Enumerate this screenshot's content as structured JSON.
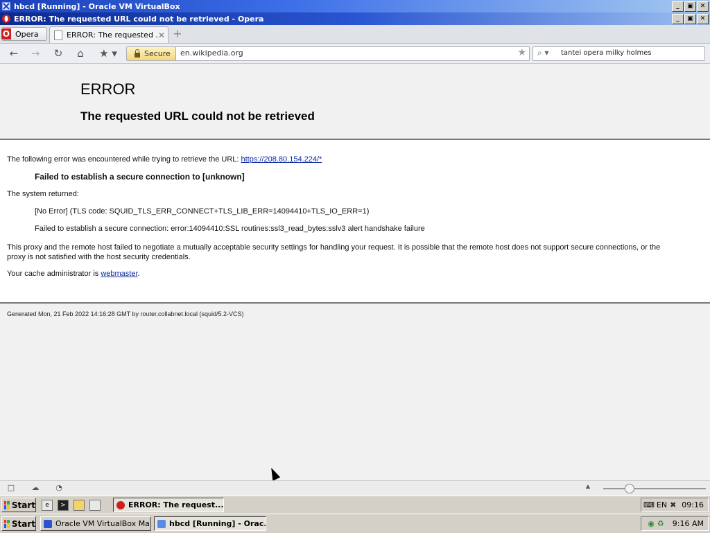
{
  "vm_window": {
    "title": "hbcd [Running] - Oracle VM VirtualBox",
    "min": "_",
    "max": "▣",
    "close": "✕"
  },
  "browser_window": {
    "title": "ERROR: The requested URL could not be retrieved - Opera",
    "min": "_",
    "max": "▣",
    "close": "✕"
  },
  "opera_menu": {
    "label": "Opera"
  },
  "tabs": [
    {
      "label": "ERROR: The requested ...",
      "close": "✕"
    }
  ],
  "new_tab": "+",
  "nav": {
    "back": "←",
    "forward": "→",
    "reload": "↻",
    "home": "⌂",
    "bookmark": "★ ▾"
  },
  "address": {
    "badge": "Secure",
    "url": "en.wikipedia.org",
    "star": "★"
  },
  "search": {
    "icon": "⌕ ▾",
    "value": "tantei opera milky holmes"
  },
  "page": {
    "title": "ERROR",
    "subtitle": "The requested URL could not be retrieved",
    "intro": "The following error was encountered while trying to retrieve the URL: ",
    "intro_link": "https://208.80.154.224/*",
    "error_heading": "Failed to establish a secure connection to [unknown]",
    "system_returned": "The system returned:",
    "tls_error": "[No Error] (TLS code: SQUID_TLS_ERR_CONNECT+TLS_LIB_ERR=14094410+TLS_IO_ERR=1)",
    "ssl_error": "Failed to establish a secure connection: error:14094410:SSL routines:ssl3_read_bytes:sslv3 alert handshake failure",
    "explanation": "This proxy and the remote host failed to negotiate a mutually acceptable security settings for handling your request. It is possible that the remote host does not support secure connections, or the proxy is not satisfied with the host security credentials.",
    "admin_prefix": "Your cache administrator is ",
    "admin_link": "webmaster",
    "admin_suffix": ".",
    "footer": "Generated Mon, 21 Feb 2022 14:16:28 GMT by router.collabnet.local (squid/5.2-VCS)"
  },
  "statusbar": {
    "panel_icon": "□",
    "cloud_icon": "☁",
    "speed_icon": "◔",
    "zoom_up": "▲",
    "zoom_level": 0.25
  },
  "guest_taskbar": {
    "start": "Start",
    "task": "ERROR: The request...",
    "lang": "EN",
    "clock": "09:16"
  },
  "host_taskbar": {
    "start": "Start",
    "tasks": [
      "Oracle VM VirtualBox Ma...",
      "hbcd [Running] - Orac..."
    ],
    "clock": "9:16 AM"
  },
  "colors": {
    "link": "#0a2aa0",
    "opera_red": "#cc1f1f",
    "title_blue": "#1a3fb8"
  }
}
